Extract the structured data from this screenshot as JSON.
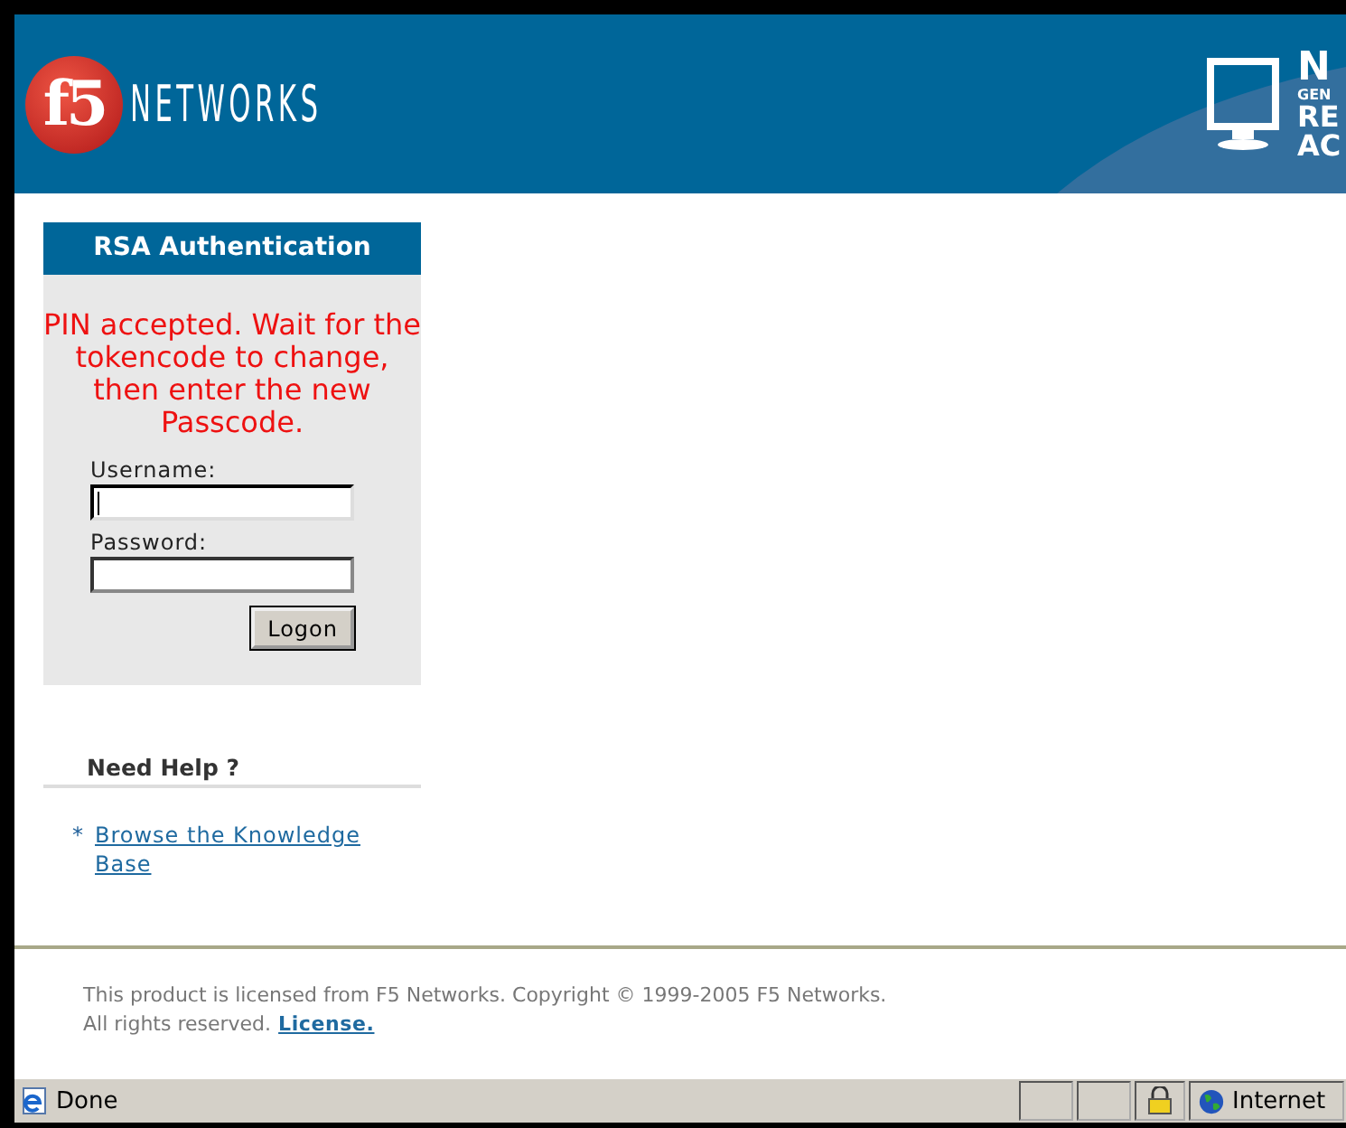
{
  "header": {
    "logo_badge": "f5",
    "logo_text": "NETWORKS",
    "banner_text": [
      "N",
      "GEN",
      "RE",
      "AC"
    ]
  },
  "login_panel": {
    "title": "RSA Authentication",
    "message": "PIN accepted. Wait for the tokencode to change, then enter the new Passcode.",
    "fields": [
      {
        "label": "Username:",
        "focused": true
      },
      {
        "label": "Password:",
        "focused": false
      }
    ],
    "button": "Logon"
  },
  "help": {
    "title": "Need Help ?",
    "links": [
      {
        "bullet": "*",
        "text": "Browse the Knowledge Base"
      }
    ]
  },
  "footer": {
    "lines": [
      "This product is licensed from F5 Networks. Copyright © 1999-2005 F5 Networks.",
      "All rights reserved."
    ],
    "link": "License."
  },
  "status_bar": {
    "status": "Done",
    "zone": "Internet"
  }
}
